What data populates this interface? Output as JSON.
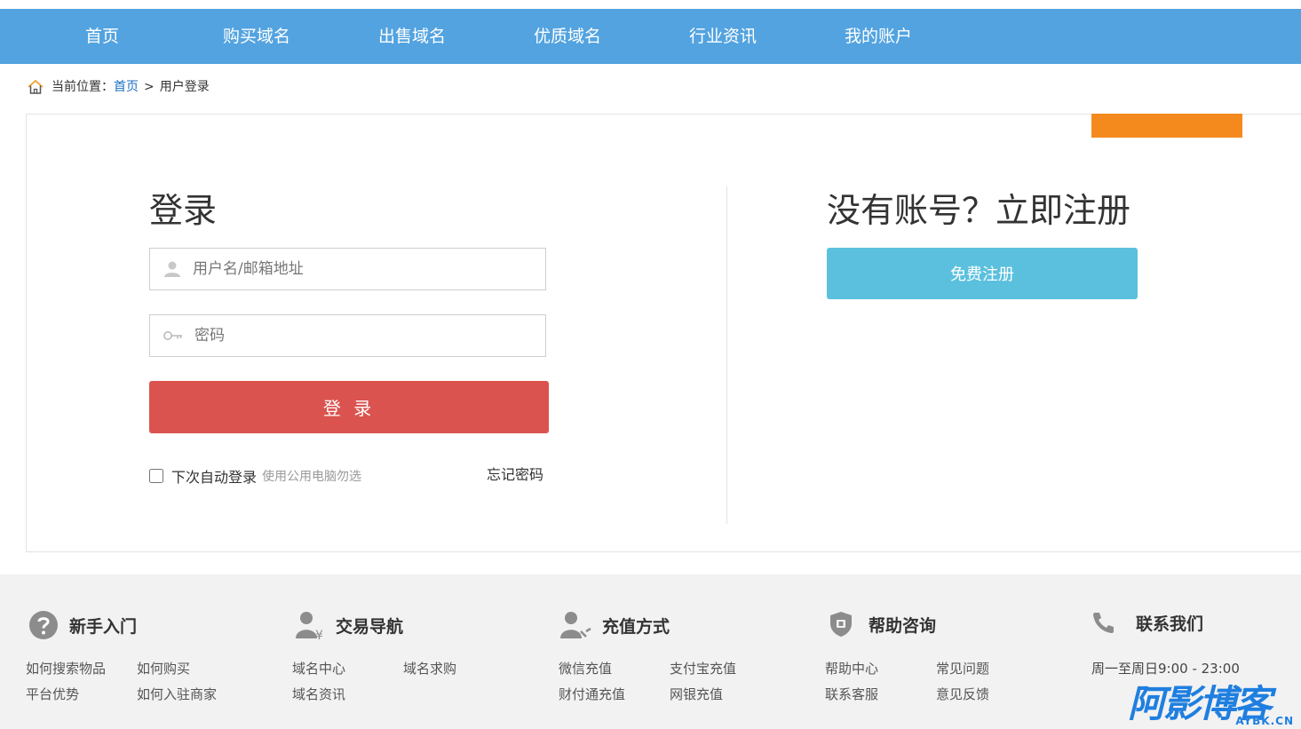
{
  "nav": {
    "items": [
      {
        "label": "首页"
      },
      {
        "label": "购买域名"
      },
      {
        "label": "出售域名"
      },
      {
        "label": "优质域名"
      },
      {
        "label": "行业资讯"
      },
      {
        "label": "我的账户"
      }
    ]
  },
  "breadcrumb": {
    "prefix": "当前位置：",
    "home": "首页",
    "separator": ">",
    "current": "用户登录"
  },
  "login": {
    "title": "登录",
    "username_placeholder": "用户名/邮箱地址",
    "password_placeholder": "密码",
    "submit_label": "登 录",
    "remember_label": "下次自动登录",
    "remember_hint": "使用公用电脑勿选",
    "forgot_label": "忘记密码"
  },
  "register": {
    "title": "没有账号？立即注册",
    "button_label": "免费注册"
  },
  "footer": {
    "columns": [
      {
        "title": "新手入门",
        "icon": "question-circle-icon",
        "links": [
          "如何搜索物品",
          "如何购买",
          "平台优势",
          "如何入驻商家"
        ]
      },
      {
        "title": "交易导航",
        "icon": "user-yen-icon",
        "links": [
          "域名中心",
          "域名求购",
          "域名资讯"
        ]
      },
      {
        "title": "充值方式",
        "icon": "user-recharge-icon",
        "links": [
          "微信充值",
          "支付宝充值",
          "财付通充值",
          "网银充值"
        ]
      },
      {
        "title": "帮助咨询",
        "icon": "shield-icon",
        "links": [
          "帮助中心",
          "常见问题",
          "联系客服",
          "意见反馈"
        ]
      },
      {
        "title": "联系我们",
        "icon": "phone-icon",
        "hours": "周一至周日9:00 - 23:00"
      }
    ]
  },
  "watermark": {
    "text": "阿影博客",
    "sub": "AYBK.CN"
  },
  "colors": {
    "nav_bg": "#53a3e0",
    "login_btn": "#da534f",
    "register_btn": "#5bc0de",
    "footer_bg": "#f2f2f2",
    "accent_orange": "#f48a1e"
  }
}
